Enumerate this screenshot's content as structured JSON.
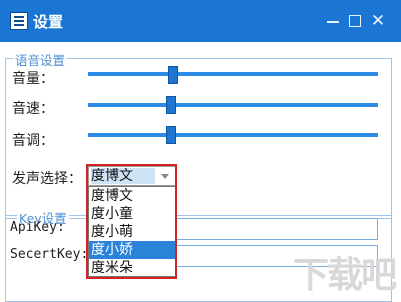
{
  "window": {
    "title": "设置",
    "icons": {
      "app": "settings-app-icon",
      "minimize": "minimize-icon",
      "maximize": "maximize-icon",
      "close": "close-icon"
    }
  },
  "voice_group": {
    "legend": "语音设置",
    "volume": {
      "label": "音量：",
      "level": 0.27
    },
    "speed": {
      "label": "音速：",
      "level": 0.26
    },
    "pitch": {
      "label": "音调：",
      "level": 0.27
    },
    "voice_select": {
      "label": "发声选择：",
      "selected": "度博文",
      "options": [
        "度博文",
        "度小童",
        "度小萌",
        "度小娇",
        "度米朵"
      ],
      "highlighted_option": "度小娇"
    }
  },
  "key_group": {
    "legend": "Key设置",
    "api_key": {
      "label": "ApiKey:",
      "value": ""
    },
    "secret_key": {
      "label": "SecertKey:",
      "value": ""
    }
  },
  "watermark": "下载吧",
  "colors": {
    "titlebar": "#1a76d2",
    "accent": "#2b8be6",
    "highlight_box": "#d22222"
  }
}
